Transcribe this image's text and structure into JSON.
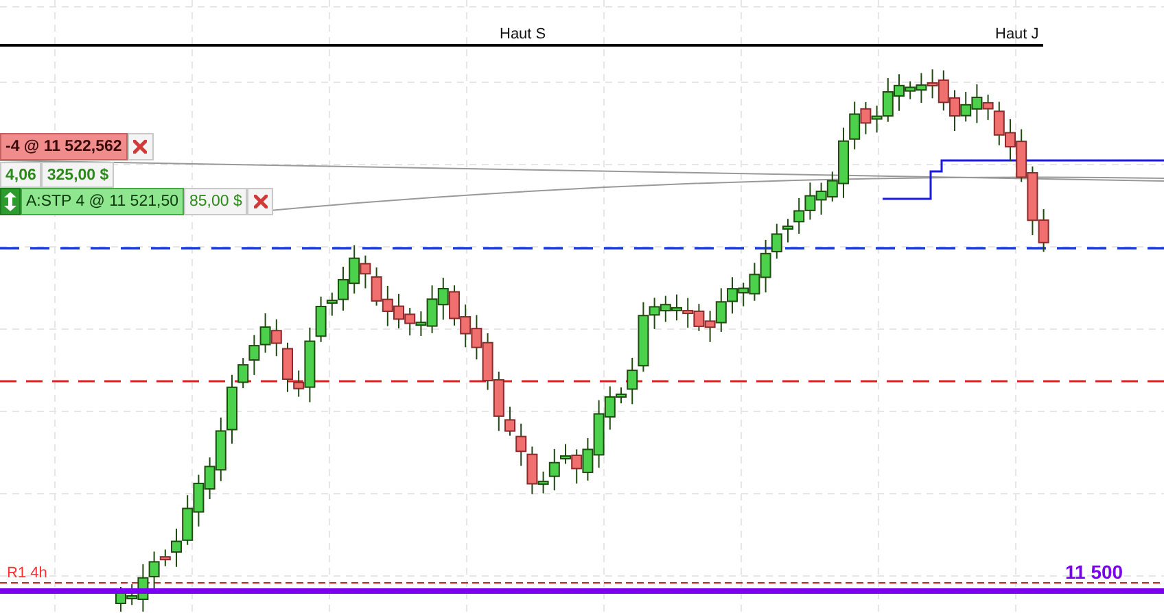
{
  "chart": {
    "high_labels": [
      "Haut S",
      "Haut J"
    ],
    "orders": [
      {
        "kind": "limit",
        "label": "-4 @ 11 522,562"
      },
      {
        "kind": "position",
        "points": "4,06",
        "amount": "325,00 $"
      },
      {
        "kind": "stop",
        "label": "A:STP 4 @ 11 521,50",
        "amount": "85,00 $"
      }
    ],
    "pivot_label": "R1 4h",
    "price_label": "11 500"
  }
}
